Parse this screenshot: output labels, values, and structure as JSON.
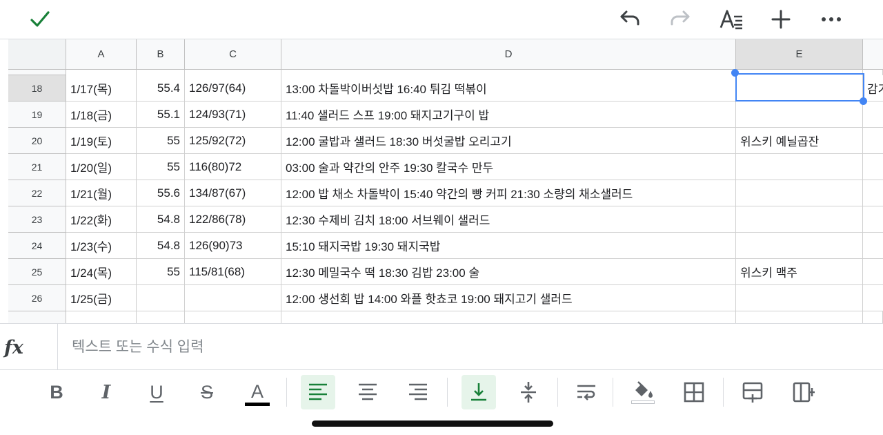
{
  "toolbar": {
    "icons": [
      "check-icon",
      "undo-icon",
      "redo-icon",
      "text-format-icon",
      "plus-icon",
      "more-icon"
    ],
    "accent": "#188038"
  },
  "columns": [
    {
      "label": "A",
      "selected": false
    },
    {
      "label": "B",
      "selected": false
    },
    {
      "label": "C",
      "selected": false
    },
    {
      "label": "D",
      "selected": false
    },
    {
      "label": "E",
      "selected": true
    }
  ],
  "rows": [
    {
      "num": "18",
      "a": "1/17(목)",
      "b": "55.4",
      "c": "126/97(64)",
      "d": "13:00 차돌박이버섯밥 16:40  튀김 떡볶이",
      "e": "",
      "f": "감기",
      "selected": true
    },
    {
      "num": "19",
      "a": "1/18(금)",
      "b": "55.1",
      "c": "124/93(71)",
      "d": "11:40 샐러드 스프 19:00 돼지고기구이 밥",
      "e": "",
      "f": ""
    },
    {
      "num": "20",
      "a": "1/19(토)",
      "b": "55",
      "c": "125/92(72)",
      "d": "12:00 굴밥과 샐러드 18:30 버섯굴밥 오리고기",
      "e": "위스키 예닐곱잔",
      "f": ""
    },
    {
      "num": "21",
      "a": "1/20(일)",
      "b": "55",
      "c": "116(80)72",
      "d": "03:00 술과 약간의 안주 19:30 칼국수 만두",
      "e": "",
      "f": ""
    },
    {
      "num": "22",
      "a": "1/21(월)",
      "b": "55.6",
      "c": "134/87(67)",
      "d": "12:00 밥 채소 차돌박이 15:40 약간의 빵 커피 21:30 소량의 채소샐러드",
      "e": "",
      "f": ""
    },
    {
      "num": "23",
      "a": "1/22(화)",
      "b": "54.8",
      "c": "122/86(78)",
      "d": "12:30 수제비 김치 18:00 서브웨이 샐러드",
      "e": "",
      "f": ""
    },
    {
      "num": "24",
      "a": "1/23(수)",
      "b": "54.8",
      "c": "126(90)73",
      "d": "15:10 돼지국밥 19:30 돼지국밥",
      "e": "",
      "f": ""
    },
    {
      "num": "25",
      "a": "1/24(목)",
      "b": "55",
      "c": "115/81(68)",
      "d": "12:30 메밀국수 떡 18:30 김밥 23:00 술",
      "e": "위스키 맥주",
      "f": ""
    },
    {
      "num": "26",
      "a": "1/25(금)",
      "b": "",
      "c": "",
      "d": "12:00 생선회 밥 14:00 와플 핫쵸코 19:00 돼지고기 샐러드",
      "e": "",
      "f": ""
    }
  ],
  "formula": {
    "placeholder": "텍스트 또는 수식 입력",
    "value": ""
  },
  "format_toolbar": {
    "bold": "B",
    "italic": "I",
    "underline": "U",
    "strike": "S",
    "text_color": "A",
    "active_color": "#e6f4ea",
    "icons": [
      "bold-icon",
      "italic-icon",
      "underline-icon",
      "strikethrough-icon",
      "text-color-icon",
      "align-left-icon",
      "align-center-icon",
      "align-right-icon",
      "valign-bottom-icon",
      "valign-middle-icon",
      "wrap-text-icon",
      "fill-color-icon",
      "borders-icon",
      "insert-row-icon",
      "insert-column-icon"
    ]
  }
}
